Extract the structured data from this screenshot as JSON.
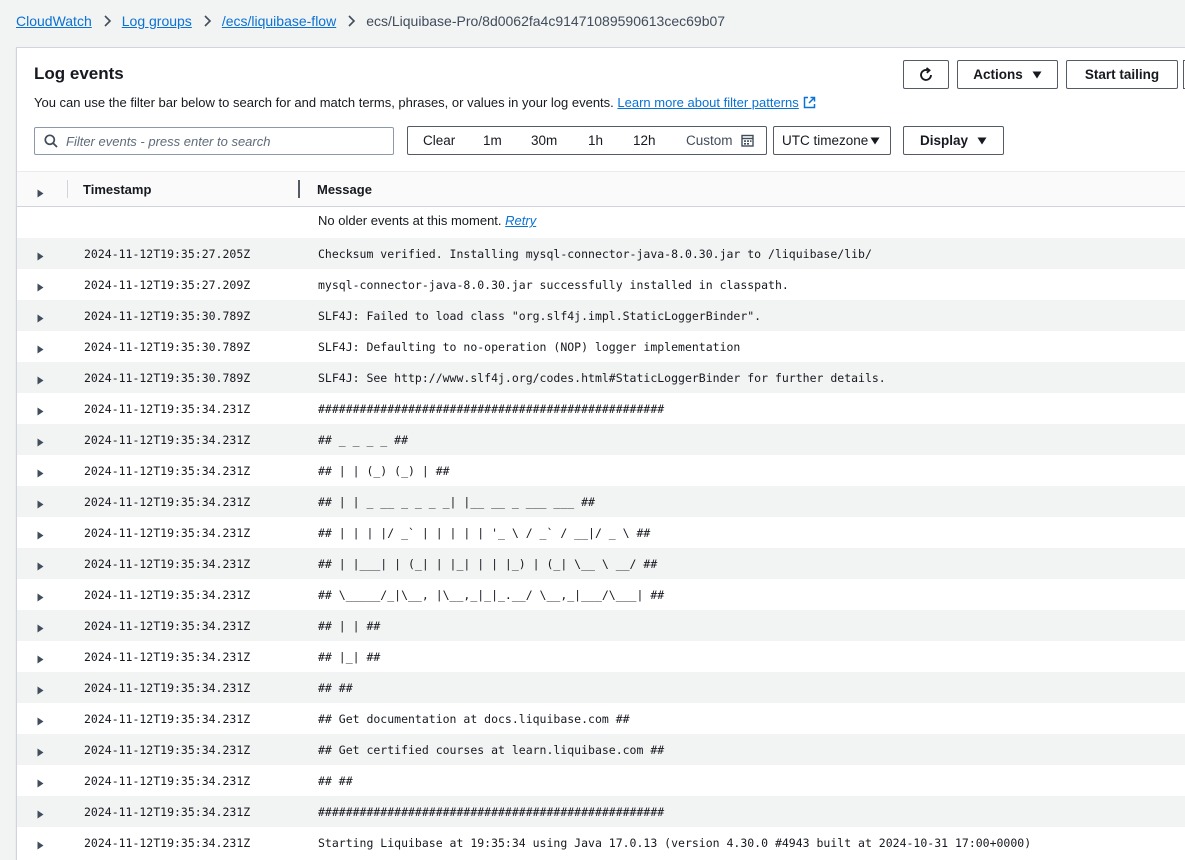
{
  "breadcrumb": {
    "items": [
      "CloudWatch",
      "Log groups",
      "/ecs/liquibase-flow"
    ],
    "current": "ecs/Liquibase-Pro/8d0062fa4c91471089590613cec69b07"
  },
  "panel": {
    "title": "Log events",
    "description": "You can use the filter bar below to search for and match terms, phrases, or values in your log events.",
    "learn_more": "Learn more about filter patterns"
  },
  "toolbar": {
    "actions_label": "Actions",
    "start_tailing_label": "Start tailing",
    "timezone_label": "UTC timezone",
    "display_label": "Display"
  },
  "search": {
    "placeholder": "Filter events - press enter to search",
    "value": ""
  },
  "range": {
    "clear": "Clear",
    "options": [
      "1m",
      "30m",
      "1h",
      "12h"
    ],
    "custom": "Custom"
  },
  "table": {
    "columns": {
      "timestamp": "Timestamp",
      "message": "Message"
    },
    "info": {
      "text": "No older events at this moment.",
      "retry": "Retry"
    },
    "rows": [
      {
        "timestamp": "2024-11-12T19:35:27.205Z",
        "message": "Checksum verified. Installing mysql-connector-java-8.0.30.jar to /liquibase/lib/"
      },
      {
        "timestamp": "2024-11-12T19:35:27.209Z",
        "message": "mysql-connector-java-8.0.30.jar successfully installed in classpath."
      },
      {
        "timestamp": "2024-11-12T19:35:30.789Z",
        "message": "SLF4J: Failed to load class \"org.slf4j.impl.StaticLoggerBinder\"."
      },
      {
        "timestamp": "2024-11-12T19:35:30.789Z",
        "message": "SLF4J: Defaulting to no-operation (NOP) logger implementation"
      },
      {
        "timestamp": "2024-11-12T19:35:30.789Z",
        "message": "SLF4J: See http://www.slf4j.org/codes.html#StaticLoggerBinder for further details."
      },
      {
        "timestamp": "2024-11-12T19:35:34.231Z",
        "message": "##################################################"
      },
      {
        "timestamp": "2024-11-12T19:35:34.231Z",
        "message": "## _ _ _ _ ##"
      },
      {
        "timestamp": "2024-11-12T19:35:34.231Z",
        "message": "## | | (_) (_) | ##"
      },
      {
        "timestamp": "2024-11-12T19:35:34.231Z",
        "message": "## | | _ __ _ _ _ _| |__ __ _ ___ ___ ##"
      },
      {
        "timestamp": "2024-11-12T19:35:34.231Z",
        "message": "## | | | |/ _` | | | | | '_ \\ / _` / __|/ _ \\ ##"
      },
      {
        "timestamp": "2024-11-12T19:35:34.231Z",
        "message": "## | |___| | (_| | |_| | | |_) | (_| \\__ \\ __/ ##"
      },
      {
        "timestamp": "2024-11-12T19:35:34.231Z",
        "message": "## \\_____/_|\\__, |\\__,_|_|_.__/ \\__,_|___/\\___| ##"
      },
      {
        "timestamp": "2024-11-12T19:35:34.231Z",
        "message": "## | | ##"
      },
      {
        "timestamp": "2024-11-12T19:35:34.231Z",
        "message": "## |_| ##"
      },
      {
        "timestamp": "2024-11-12T19:35:34.231Z",
        "message": "## ##"
      },
      {
        "timestamp": "2024-11-12T19:35:34.231Z",
        "message": "## Get documentation at docs.liquibase.com ##"
      },
      {
        "timestamp": "2024-11-12T19:35:34.231Z",
        "message": "## Get certified courses at learn.liquibase.com ##"
      },
      {
        "timestamp": "2024-11-12T19:35:34.231Z",
        "message": "## ##"
      },
      {
        "timestamp": "2024-11-12T19:35:34.231Z",
        "message": "##################################################"
      },
      {
        "timestamp": "2024-11-12T19:35:34.231Z",
        "message": "Starting Liquibase at 19:35:34 using Java 17.0.13 (version 4.30.0 #4943 built at 2024-10-31 17:00+0000)"
      }
    ]
  },
  "colors": {
    "link": "#0972d3",
    "text": "#16191f",
    "row_alt": "#f2f3f3"
  },
  "icons": [
    "chevron-right-icon",
    "refresh-icon",
    "caret-down-icon",
    "search-icon",
    "calendar-icon",
    "external-link-icon",
    "expand-row-icon"
  ]
}
